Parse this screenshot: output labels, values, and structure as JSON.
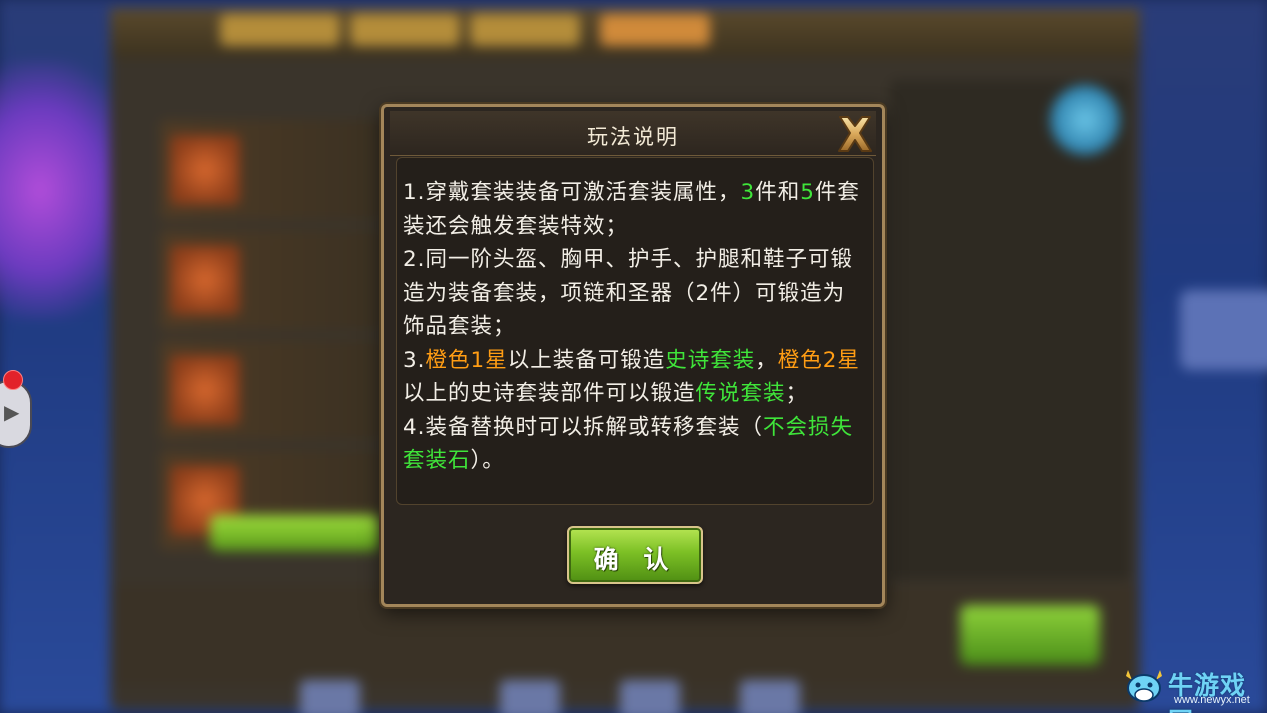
{
  "dialog": {
    "title": "玩法说明",
    "confirm_label": "确 认",
    "rules": [
      [
        {
          "text": "1.穿戴套装装备可激活套装属性，",
          "color": "white"
        },
        {
          "text": "3",
          "color": "green"
        },
        {
          "text": "件和",
          "color": "white"
        },
        {
          "text": "5",
          "color": "green"
        },
        {
          "text": "件套装还会触发套装特效；",
          "color": "white"
        }
      ],
      [
        {
          "text": "2.同一阶头盔、胸甲、护手、护腿和鞋子可锻造为装备套装，项链和圣器（2件）可锻造为饰品套装；",
          "color": "white"
        }
      ],
      [
        {
          "text": "3.",
          "color": "white"
        },
        {
          "text": "橙色1星",
          "color": "orange"
        },
        {
          "text": "以上装备可锻造",
          "color": "white"
        },
        {
          "text": "史诗套装",
          "color": "green"
        },
        {
          "text": "，",
          "color": "white"
        },
        {
          "text": "橙色2星",
          "color": "orange"
        },
        {
          "text": "以上的史诗套装部件可以锻造",
          "color": "white"
        },
        {
          "text": "传说套装",
          "color": "green"
        },
        {
          "text": "；",
          "color": "white"
        }
      ],
      [
        {
          "text": "4.装备替换时可以拆解或转移套装（",
          "color": "white"
        },
        {
          "text": "不会损失套装石",
          "color": "green"
        },
        {
          "text": "）。",
          "color": "white"
        }
      ]
    ]
  },
  "colors": {
    "green": "#3fe53a",
    "orange": "#ff9d14",
    "white": "#f2eee6",
    "frame": "#a3865a"
  },
  "icons": {
    "close": "close-x-icon",
    "watermark_logo": "cow-head-icon"
  },
  "watermark": {
    "name": "牛游戏网",
    "url": "www.newyx.net"
  }
}
